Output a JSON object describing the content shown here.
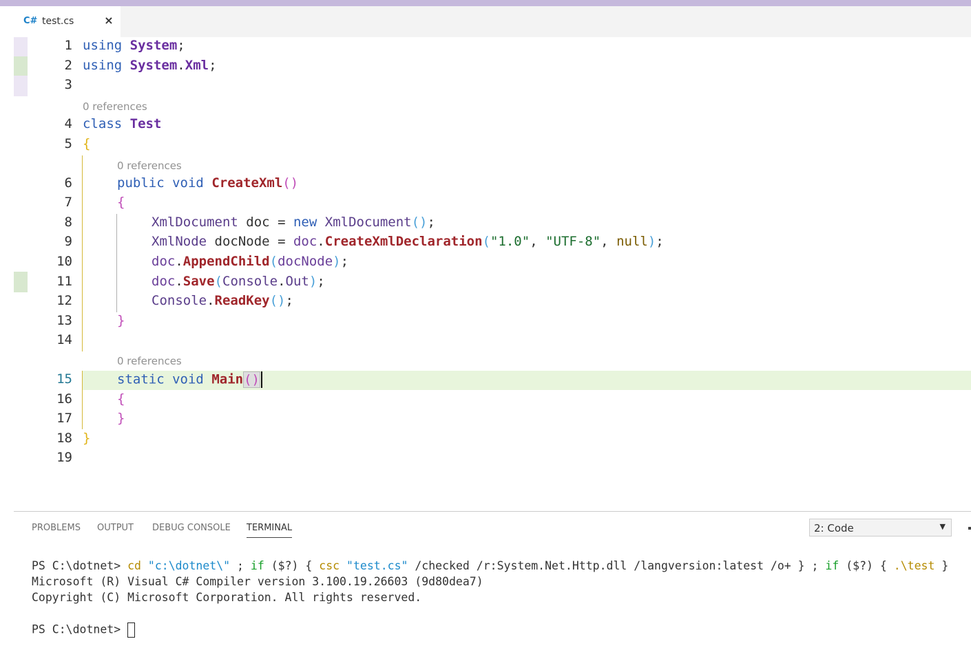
{
  "tab": {
    "icon": "C#",
    "filename": "test.cs",
    "close": "×"
  },
  "editor": {
    "line_numbers": [
      "1",
      "2",
      "3",
      "4",
      "5",
      "6",
      "7",
      "8",
      "9",
      "10",
      "11",
      "12",
      "13",
      "14",
      "15",
      "16",
      "17",
      "18",
      "19"
    ],
    "codelens": "0 references",
    "tokens": {
      "using": "using",
      "system": "System",
      "dot": ".",
      "xml": "Xml",
      "semi": ";",
      "class": "class",
      "test": "Test",
      "lbrace": "{",
      "rbrace": "}",
      "public": "public",
      "void": "void",
      "createxml": "CreateXml",
      "parens": "()",
      "lparen": "(",
      "rparen": ")",
      "xmldocument": "XmlDocument",
      "doc": "doc",
      "eq": "=",
      "new": "new",
      "xmlnode": "XmlNode",
      "docnode": "docNode",
      "createxmldecl": "CreateXmlDeclaration",
      "str1": "\"1.0\"",
      "str2": "\"UTF-8\"",
      "comma": ",",
      "null": "null",
      "appendchild": "AppendChild",
      "save": "Save",
      "console": "Console",
      "out": "Out",
      "readkey": "ReadKey",
      "static": "static",
      "main": "Main"
    }
  },
  "panel": {
    "tabs": [
      "PROBLEMS",
      "OUTPUT",
      "DEBUG CONSOLE",
      "TERMINAL"
    ],
    "active_tab": "TERMINAL",
    "terminal_select": "2: Code",
    "select_arrow": "▼",
    "terminal": {
      "prompt": "PS C:\\dotnet> ",
      "cmd_cd": "cd",
      "arg_dir": "\"c:\\dotnet\\\"",
      "sep1": " ; ",
      "kw_if": "if",
      "cond": " ($?) ",
      "lb": "{",
      "rb": "}",
      "csc": "csc",
      "arg_file": "\"test.cs\"",
      "csc_flags": " /checked /r:System.Net.Http.dll /langversion:latest /o+ ",
      "run": ".\\test",
      "line2": "Microsoft (R) Visual C# Compiler version 3.100.19.26603 (9d80dea7)",
      "line3": "Copyright (C) Microsoft Corporation. All rights reserved.",
      "line4": "PS C:\\dotnet> "
    }
  },
  "colors": {
    "title_accent": "#c5b8dc",
    "current_line": "#e8f5dc",
    "line_number": "#237893",
    "keyword": "#2f5fb5",
    "method": "#a0262b",
    "string": "#1b6d2e"
  }
}
